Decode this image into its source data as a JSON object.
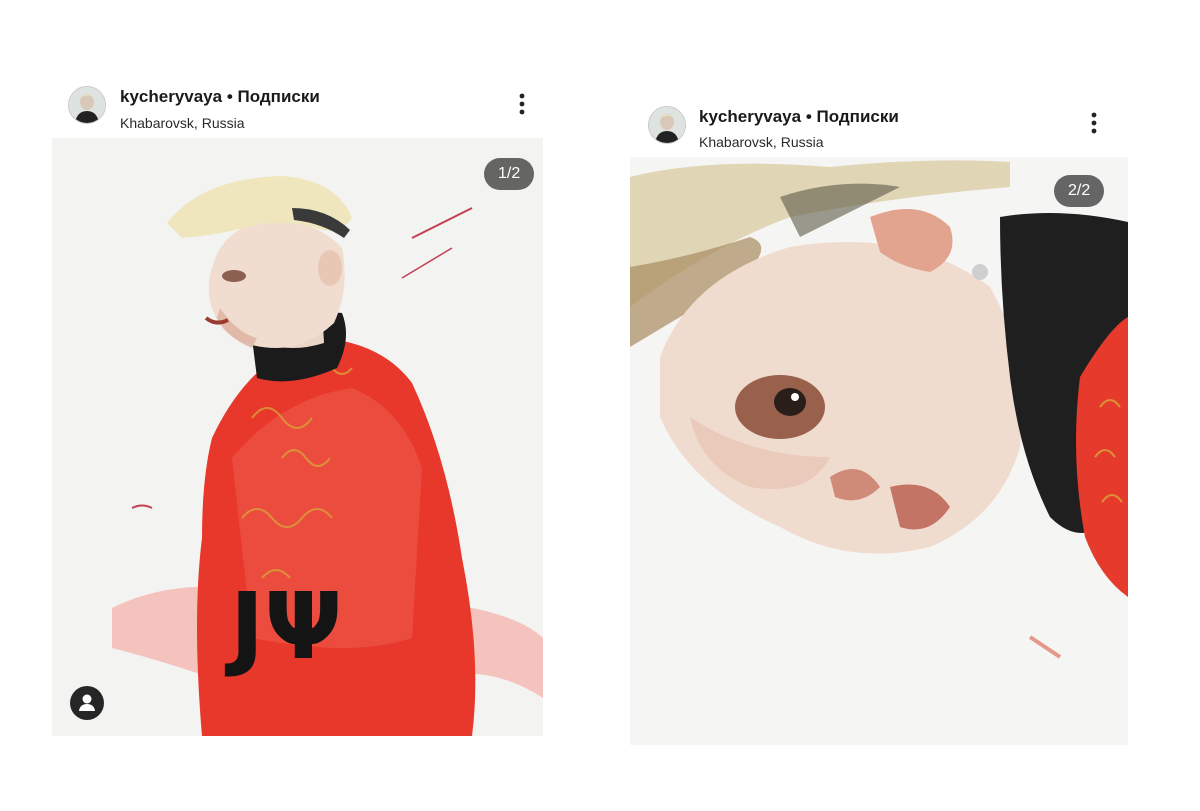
{
  "posts": [
    {
      "username": "kycheryvaya",
      "separator": "•",
      "follow_label": "Подписки",
      "location": "Khabarovsk, Russia",
      "counter": "1/2",
      "icons": {
        "more": "more-vert-icon",
        "tag": "user-tag-icon"
      },
      "artwork_text": "JΨ"
    },
    {
      "username": "kycheryvaya",
      "separator": "•",
      "follow_label": "Подписки",
      "location": "Khabarovsk, Russia",
      "counter": "2/2",
      "icons": {
        "more": "more-vert-icon"
      }
    }
  ],
  "colors": {
    "jacket_red": "#e8382b",
    "text": "#1a1a1a",
    "counter_bg": "#3c3c3c"
  }
}
